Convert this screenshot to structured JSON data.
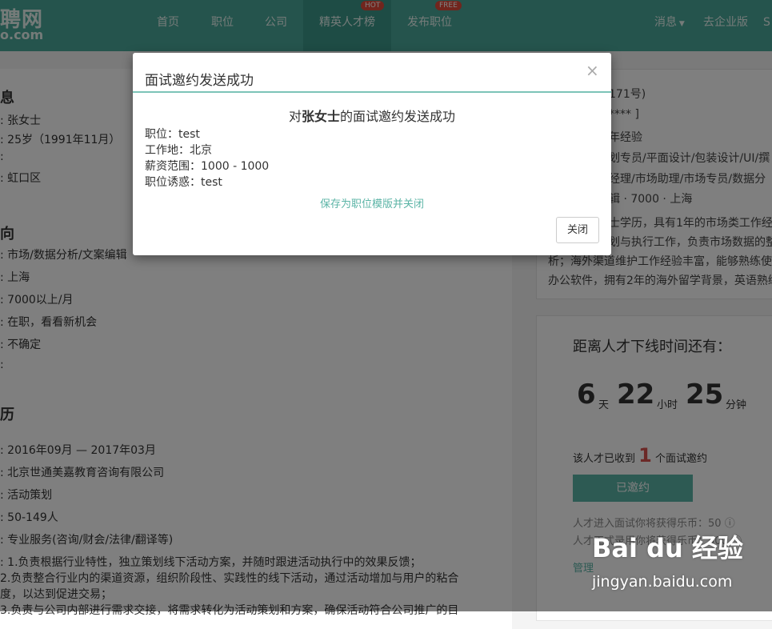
{
  "header": {
    "logo_line1": "聘网",
    "logo_line2": "o.com",
    "nav": [
      {
        "label": "首页"
      },
      {
        "label": "职位"
      },
      {
        "label": "公司"
      },
      {
        "label": "精英人才榜",
        "badge": "HOT"
      },
      {
        "label": "发布职位",
        "badge": "FREE"
      }
    ],
    "messages": "消息",
    "enterprise": "去企业版",
    "extra": "S"
  },
  "resume": {
    "basic_title": "息",
    "basic": [
      ": 张女士",
      ": 25岁（1991年11月）",
      ":",
      ": 虹口区"
    ],
    "intent_title": "向",
    "intent": [
      ": 市场/数据分析/文案编辑",
      ": 上海",
      ": 7000以上/月",
      ": 在职，看看新机会",
      ": 不确定",
      ":"
    ],
    "exp_title": "历",
    "exp": [
      ": 2016年09月 — 2017年03月",
      ": 北京世通美嘉教育咨询有限公司",
      ": 活动策划",
      ": 50-149人",
      ": 专业服务(咨询/财会/法律/翻译等)",
      ": 1.负责根据行业特性，独立策划线下活动方案，并随时跟进活动执行中的效果反馈；",
      "  2.负责整合行业内的渠道资源，组织阶段性、实践性的线下活动，通过活动增加与用户的粘合",
      "  度，以达到促进交易；",
      "  3.负责与公司内部进行需求交接，将需求转化为活动策划和方案，确保活动符合公司推广的目"
    ]
  },
  "right_card": {
    "lines": [
      "171号)",
      "**** ]",
      "年经验",
      "划专员/平面设计/包装设计/UI/撰",
      "经理/市场助理/市场专员/数据分",
      "辑 · 7000 · 上海",
      "士学历，具有1年的市场类工作经",
      "划与执行工作，负责市场数据的整",
      "析；海外渠道维护工作经验丰富，能够熟练使",
      "办公软件，拥有2年的海外留学背景，英语熟练"
    ]
  },
  "timer": {
    "title": "距离人才下线时间还有：",
    "days": "6",
    "days_unit": "天",
    "hours": "22",
    "hours_unit": "小时",
    "minutes": "25",
    "minutes_unit": "分钟",
    "received_prefix": "该人才已收到",
    "received_count": "1",
    "received_suffix": "个面试邀约",
    "invited_button": "已邀约",
    "coin_line1": "人才进入面试你将获得乐币：50",
    "coin_line2": "人才正式录用你将获得乐币：500",
    "manage": "管理"
  },
  "modal": {
    "title": "面试邀约发送成功",
    "close_symbol": "×",
    "headline_prefix": "对",
    "headline_name": "张女士",
    "headline_suffix": "的面试邀约发送成功",
    "rows": [
      "职位：test",
      "工作地：北京",
      "薪资范围：1000 - 1000",
      "职位诱惑：test"
    ],
    "save_link": "保存为职位模版并关闭",
    "close_button": "关闭"
  },
  "watermark": {
    "main": "Bai du 经验",
    "sub": "jingyan.baidu.com"
  },
  "colors": {
    "header": "#4aa89a",
    "accent": "#5bb4a6",
    "badge": "#e24b3b",
    "count": "#d9534f"
  }
}
